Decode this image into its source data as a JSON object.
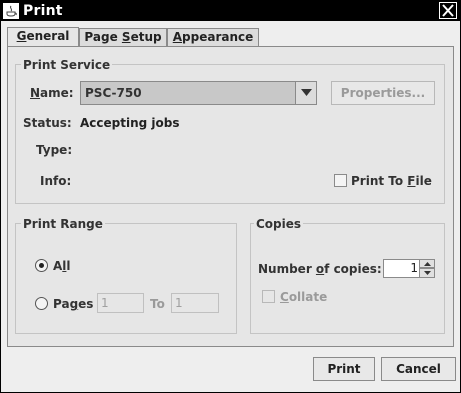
{
  "window": {
    "title": "Print"
  },
  "tabs": [
    {
      "label_pre": "",
      "label_u": "G",
      "label_post": "eneral"
    },
    {
      "label_pre": "Page ",
      "label_u": "S",
      "label_post": "etup"
    },
    {
      "label_pre": "",
      "label_u": "A",
      "label_post": "ppearance"
    }
  ],
  "print_service": {
    "title": "Print Service",
    "name_label_u": "N",
    "name_label_post": "ame:",
    "printer_value": "PSC-750",
    "properties_label": "Properties...",
    "status_label": "Status:",
    "status_value": "Accepting jobs",
    "type_label": "Type:",
    "info_label": "Info:",
    "print_to_file_pre": "Print To ",
    "print_to_file_u": "F",
    "print_to_file_post": "ile"
  },
  "print_range": {
    "title": "Print Range",
    "all_pre": "A",
    "all_u": "l",
    "all_post": "l",
    "pages_pre": "Pa",
    "pages_u": "g",
    "pages_post": "es",
    "from_value": "1",
    "to_label": "To",
    "to_value": "1"
  },
  "copies": {
    "title": "Copies",
    "number_pre": "Number ",
    "number_u": "o",
    "number_post": "f copies:",
    "copies_value": "1",
    "collate_u": "C",
    "collate_post": "ollate"
  },
  "footer": {
    "print_label": "Print",
    "cancel_label": "Cancel"
  }
}
